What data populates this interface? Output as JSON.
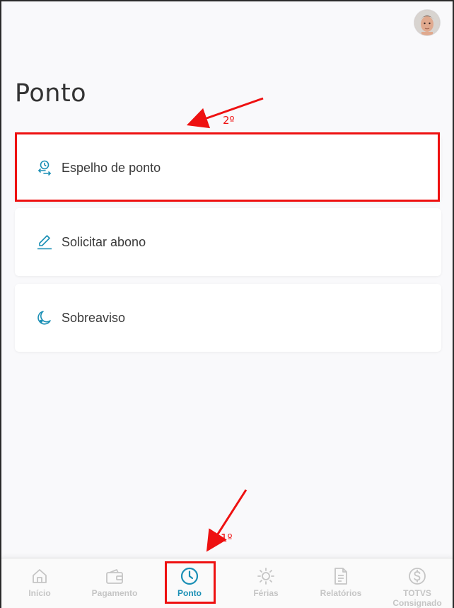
{
  "header": {
    "avatar_alt": "user avatar"
  },
  "page": {
    "title": "Ponto"
  },
  "menu": {
    "items": [
      {
        "label": "Espelho de ponto",
        "icon": "clock-transfer-icon"
      },
      {
        "label": "Solicitar abono",
        "icon": "pencil-icon"
      },
      {
        "label": "Sobreaviso",
        "icon": "moon-icon"
      }
    ]
  },
  "annotations": {
    "first": "1º",
    "second": "2º",
    "color": "#ee1111"
  },
  "bottom_nav": {
    "active_color": "#1a8fb5",
    "inactive_color": "#c5c5c5",
    "items": [
      {
        "label": "Início",
        "icon": "home-icon",
        "active": false
      },
      {
        "label": "Pagamento",
        "icon": "wallet-icon",
        "active": false
      },
      {
        "label": "Ponto",
        "icon": "clock-icon",
        "active": true
      },
      {
        "label": "Férias",
        "icon": "sun-icon",
        "active": false
      },
      {
        "label": "Relatórios",
        "icon": "document-icon",
        "active": false
      },
      {
        "label": "TOTVS Consignado",
        "icon": "dollar-circle-icon",
        "active": false
      }
    ]
  }
}
